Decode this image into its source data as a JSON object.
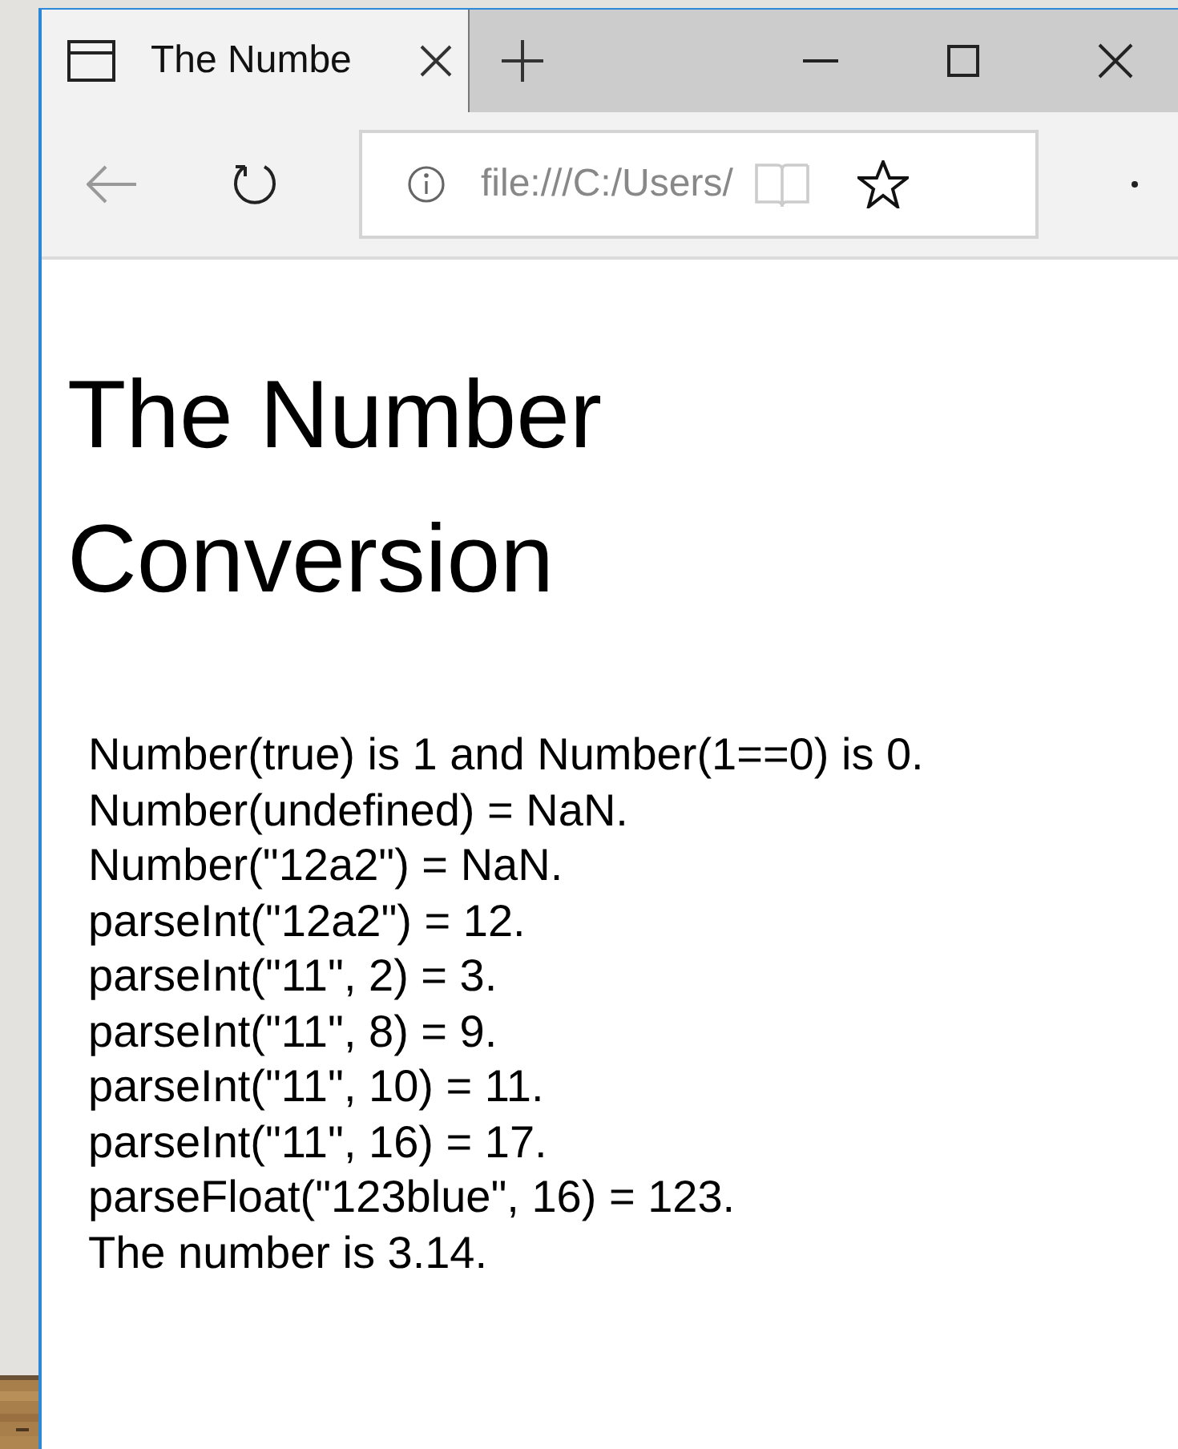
{
  "tab": {
    "title": "The Numbe"
  },
  "address_bar": {
    "url": "file:///C:/Users/"
  },
  "page": {
    "heading": "The Number Conversion",
    "lines": [
      "Number(true) is 1 and Number(1==0) is 0.",
      "Number(undefined) = NaN.",
      "Number(\"12a2\") = NaN.",
      "parseInt(\"12a2\") = 12.",
      "parseInt(\"11\", 2) = 3.",
      "parseInt(\"11\", 8) = 9.",
      "parseInt(\"11\", 10) = 11.",
      "parseInt(\"11\", 16) = 17.",
      "parseFloat(\"123blue\", 16) = 123.",
      "The number is 3.14."
    ]
  }
}
